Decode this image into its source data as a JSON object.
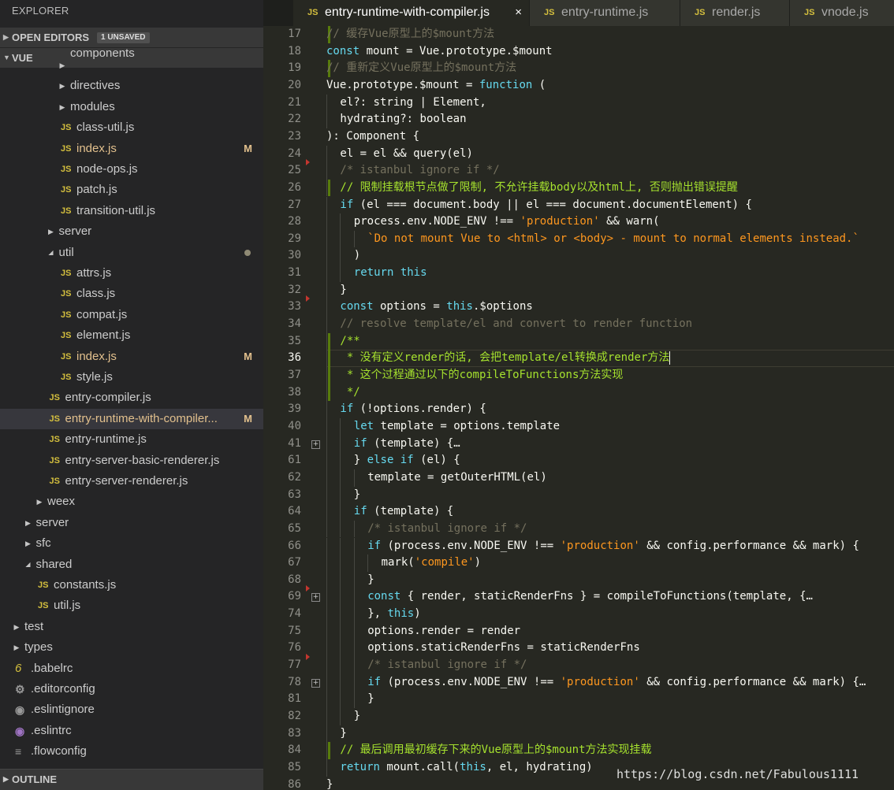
{
  "sidebar": {
    "title": "EXPLORER",
    "open_editors": {
      "label": "OPEN EDITORS",
      "badge": "1 UNSAVED"
    },
    "root": {
      "label": "VUE"
    },
    "outline": {
      "label": "OUTLINE"
    },
    "items": [
      {
        "label": "components",
        "type": "folder",
        "depth": 4,
        "arrow": "right"
      },
      {
        "label": "directives",
        "type": "folder",
        "depth": 4,
        "arrow": "right"
      },
      {
        "label": "modules",
        "type": "folder",
        "depth": 4,
        "arrow": "right"
      },
      {
        "label": "class-util.js",
        "type": "js",
        "depth": 4
      },
      {
        "label": "index.js",
        "type": "js",
        "depth": 4,
        "status": "M"
      },
      {
        "label": "node-ops.js",
        "type": "js",
        "depth": 4
      },
      {
        "label": "patch.js",
        "type": "js",
        "depth": 4
      },
      {
        "label": "transition-util.js",
        "type": "js",
        "depth": 4
      },
      {
        "label": "server",
        "type": "folder",
        "depth": 3,
        "arrow": "right"
      },
      {
        "label": "util",
        "type": "folder",
        "depth": 3,
        "arrow": "down",
        "status": "dot"
      },
      {
        "label": "attrs.js",
        "type": "js",
        "depth": 4
      },
      {
        "label": "class.js",
        "type": "js",
        "depth": 4
      },
      {
        "label": "compat.js",
        "type": "js",
        "depth": 4
      },
      {
        "label": "element.js",
        "type": "js",
        "depth": 4
      },
      {
        "label": "index.js",
        "type": "js",
        "depth": 4,
        "status": "M"
      },
      {
        "label": "style.js",
        "type": "js",
        "depth": 4
      },
      {
        "label": "entry-compiler.js",
        "type": "js",
        "depth": 3
      },
      {
        "label": "entry-runtime-with-compiler...",
        "type": "js",
        "depth": 3,
        "status": "M",
        "selected": true
      },
      {
        "label": "entry-runtime.js",
        "type": "js",
        "depth": 3
      },
      {
        "label": "entry-server-basic-renderer.js",
        "type": "js",
        "depth": 3
      },
      {
        "label": "entry-server-renderer.js",
        "type": "js",
        "depth": 3
      },
      {
        "label": "weex",
        "type": "folder",
        "depth": 2,
        "arrow": "right"
      },
      {
        "label": "server",
        "type": "folder",
        "depth": 1,
        "arrow": "right"
      },
      {
        "label": "sfc",
        "type": "folder",
        "depth": 1,
        "arrow": "right"
      },
      {
        "label": "shared",
        "type": "folder",
        "depth": 1,
        "arrow": "down"
      },
      {
        "label": "constants.js",
        "type": "js",
        "depth": 2
      },
      {
        "label": "util.js",
        "type": "js",
        "depth": 2
      },
      {
        "label": "test",
        "type": "folder",
        "depth": 0,
        "arrow": "right"
      },
      {
        "label": "types",
        "type": "folder",
        "depth": 0,
        "arrow": "right"
      },
      {
        "label": ".babelrc",
        "type": "babel",
        "depth": 0
      },
      {
        "label": ".editorconfig",
        "type": "gear",
        "depth": 0
      },
      {
        "label": ".eslintignore",
        "type": "eslint-gray",
        "depth": 0
      },
      {
        "label": ".eslintrc",
        "type": "eslint",
        "depth": 0
      },
      {
        "label": ".flowconfig",
        "type": "lines",
        "depth": 0
      }
    ]
  },
  "tabs": [
    {
      "label": "entry-runtime-with-compiler.js",
      "icon": "JS",
      "active": true,
      "close": "×"
    },
    {
      "label": "entry-runtime.js",
      "icon": "JS",
      "active": false
    },
    {
      "label": "render.js",
      "icon": "JS",
      "active": false
    },
    {
      "label": "vnode.js",
      "icon": "JS",
      "active": false
    }
  ],
  "editor": {
    "lines": [
      {
        "n": "17",
        "indent": 0,
        "t": [
          [
            "cm",
            "// 缓存Vue原型上的$mount方法"
          ]
        ],
        "mark": "bar"
      },
      {
        "n": "18",
        "indent": 0,
        "t": [
          [
            "kw",
            "const"
          ],
          [
            "pu",
            " mount = Vue.prototype.$mount"
          ]
        ]
      },
      {
        "n": "19",
        "indent": 0,
        "t": [
          [
            "cm",
            "// 重新定义Vue原型上的$mount方法"
          ]
        ],
        "mark": "bar"
      },
      {
        "n": "20",
        "indent": 0,
        "t": [
          [
            "pu",
            "Vue.prototype.$mount = "
          ],
          [
            "kw",
            "function"
          ],
          [
            "pu",
            " ("
          ]
        ]
      },
      {
        "n": "21",
        "indent": 1,
        "t": [
          [
            "pu",
            "el?: string | Element,"
          ]
        ]
      },
      {
        "n": "22",
        "indent": 1,
        "t": [
          [
            "pu",
            "hydrating?: boolean"
          ]
        ]
      },
      {
        "n": "23",
        "indent": 0,
        "t": [
          [
            "pu",
            "): Component {"
          ]
        ]
      },
      {
        "n": "24",
        "indent": 1,
        "t": [
          [
            "pu",
            "el = el && query(el)"
          ]
        ]
      },
      {
        "n": "25",
        "indent": 1,
        "t": [
          [
            "cm",
            "/* istanbul ignore if */"
          ]
        ],
        "mark": "tri"
      },
      {
        "n": "26",
        "indent": 1,
        "t": [
          [
            "cc",
            "// 限制挂载根节点做了限制, 不允许挂载body以及html上, 否则抛出错误提醒"
          ]
        ],
        "mark": "bar"
      },
      {
        "n": "27",
        "indent": 1,
        "t": [
          [
            "kw",
            "if"
          ],
          [
            "pu",
            " (el === document.body || el === document.documentElement) {"
          ]
        ]
      },
      {
        "n": "28",
        "indent": 2,
        "t": [
          [
            "pu",
            "process.env.NODE_ENV !== "
          ],
          [
            "st2",
            "'production'"
          ],
          [
            "pu",
            " && warn("
          ]
        ]
      },
      {
        "n": "29",
        "indent": 3,
        "t": [
          [
            "st2",
            "`Do not mount Vue to <html> or <body> - mount to normal elements instead.`"
          ]
        ]
      },
      {
        "n": "30",
        "indent": 2,
        "t": [
          [
            "pu",
            ")"
          ]
        ]
      },
      {
        "n": "31",
        "indent": 2,
        "t": [
          [
            "kw",
            "return"
          ],
          [
            "pu",
            " "
          ],
          [
            "kw",
            "this"
          ]
        ]
      },
      {
        "n": "32",
        "indent": 1,
        "t": [
          [
            "pu",
            "}"
          ]
        ]
      },
      {
        "n": "33",
        "indent": 1,
        "t": [
          [
            "kw",
            "const"
          ],
          [
            "pu",
            " options = "
          ],
          [
            "kw",
            "this"
          ],
          [
            "pu",
            ".$options"
          ]
        ],
        "mark": "tri"
      },
      {
        "n": "34",
        "indent": 1,
        "t": [
          [
            "cm",
            "// resolve template/el and convert to render function"
          ]
        ]
      },
      {
        "n": "35",
        "indent": 1,
        "t": [
          [
            "cc",
            "/**"
          ]
        ],
        "mark": "bar"
      },
      {
        "n": "36",
        "indent": 1,
        "t": [
          [
            "cc",
            " * 没有定义render的话, 会把template/el转换成render方法"
          ]
        ],
        "mark": "bar",
        "current": true
      },
      {
        "n": "37",
        "indent": 1,
        "t": [
          [
            "cc",
            " * 这个过程通过以下的compileToFunctions方法实现"
          ]
        ],
        "mark": "bar"
      },
      {
        "n": "38",
        "indent": 1,
        "t": [
          [
            "cc",
            " */"
          ]
        ],
        "mark": "bar"
      },
      {
        "n": "39",
        "indent": 1,
        "t": [
          [
            "kw",
            "if"
          ],
          [
            "pu",
            " (!options.render) {"
          ]
        ]
      },
      {
        "n": "40",
        "indent": 2,
        "t": [
          [
            "kw",
            "let"
          ],
          [
            "pu",
            " template = options.template"
          ]
        ]
      },
      {
        "n": "41",
        "indent": 2,
        "t": [
          [
            "kw",
            "if"
          ],
          [
            "pu",
            " (template) {…"
          ]
        ],
        "fold": "+"
      },
      {
        "n": "61",
        "indent": 2,
        "t": [
          [
            "pu",
            "} "
          ],
          [
            "kw",
            "else if"
          ],
          [
            "pu",
            " (el) {"
          ]
        ]
      },
      {
        "n": "62",
        "indent": 3,
        "t": [
          [
            "pu",
            "template = getOuterHTML(el)"
          ]
        ]
      },
      {
        "n": "63",
        "indent": 2,
        "t": [
          [
            "pu",
            "}"
          ]
        ]
      },
      {
        "n": "64",
        "indent": 2,
        "t": [
          [
            "kw",
            "if"
          ],
          [
            "pu",
            " (template) {"
          ]
        ]
      },
      {
        "n": "65",
        "indent": 3,
        "t": [
          [
            "cm",
            "/* istanbul ignore if */"
          ]
        ]
      },
      {
        "n": "66",
        "indent": 3,
        "t": [
          [
            "kw",
            "if"
          ],
          [
            "pu",
            " (process.env.NODE_ENV !== "
          ],
          [
            "st2",
            "'production'"
          ],
          [
            "pu",
            " && config.performance && mark) {"
          ]
        ]
      },
      {
        "n": "67",
        "indent": 4,
        "t": [
          [
            "pu",
            "mark("
          ],
          [
            "st2",
            "'compile'"
          ],
          [
            "pu",
            ")"
          ]
        ]
      },
      {
        "n": "68",
        "indent": 3,
        "t": [
          [
            "pu",
            "}"
          ]
        ]
      },
      {
        "n": "69",
        "indent": 3,
        "t": [
          [
            "kw",
            "const"
          ],
          [
            "pu",
            " { render, staticRenderFns } = compileToFunctions(template, {…"
          ]
        ],
        "fold": "+",
        "mark": "tri"
      },
      {
        "n": "74",
        "indent": 3,
        "t": [
          [
            "pu",
            "}, "
          ],
          [
            "kw",
            "this"
          ],
          [
            "pu",
            ")"
          ]
        ]
      },
      {
        "n": "75",
        "indent": 3,
        "t": [
          [
            "pu",
            "options.render = render"
          ]
        ]
      },
      {
        "n": "76",
        "indent": 3,
        "t": [
          [
            "pu",
            "options.staticRenderFns = staticRenderFns"
          ]
        ]
      },
      {
        "n": "77",
        "indent": 3,
        "t": [
          [
            "cm",
            "/* istanbul ignore if */"
          ]
        ],
        "mark": "tri"
      },
      {
        "n": "78",
        "indent": 3,
        "t": [
          [
            "kw",
            "if"
          ],
          [
            "pu",
            " (process.env.NODE_ENV !== "
          ],
          [
            "st2",
            "'production'"
          ],
          [
            "pu",
            " && config.performance && mark) {…"
          ]
        ],
        "fold": "+"
      },
      {
        "n": "81",
        "indent": 3,
        "t": [
          [
            "pu",
            "}"
          ]
        ]
      },
      {
        "n": "82",
        "indent": 2,
        "t": [
          [
            "pu",
            "}"
          ]
        ]
      },
      {
        "n": "83",
        "indent": 1,
        "t": [
          [
            "pu",
            "}"
          ]
        ]
      },
      {
        "n": "84",
        "indent": 1,
        "t": [
          [
            "cc",
            "// 最后调用最初缓存下来的Vue原型上的$mount方法实现挂载"
          ]
        ],
        "mark": "bar"
      },
      {
        "n": "85",
        "indent": 1,
        "t": [
          [
            "kw",
            "return"
          ],
          [
            "pu",
            " mount.call("
          ],
          [
            "kw",
            "this"
          ],
          [
            "pu",
            ", el, hydrating)"
          ]
        ]
      },
      {
        "n": "86",
        "indent": 0,
        "t": [
          [
            "pu",
            "}"
          ]
        ]
      }
    ]
  },
  "watermark": "https://blog.csdn.net/Fabulous1111",
  "colors": {
    "sidebar_bg": "#252526",
    "editor_bg": "#272822",
    "keyword": "#66d9ef",
    "string": "#fd971f",
    "comment": "#75715e",
    "comment_added": "#a6e22e",
    "js_icon": "#d4bf3e",
    "modified": "#e2c08d",
    "git_added": "#587c0c",
    "git_deleted": "#c4362f"
  }
}
